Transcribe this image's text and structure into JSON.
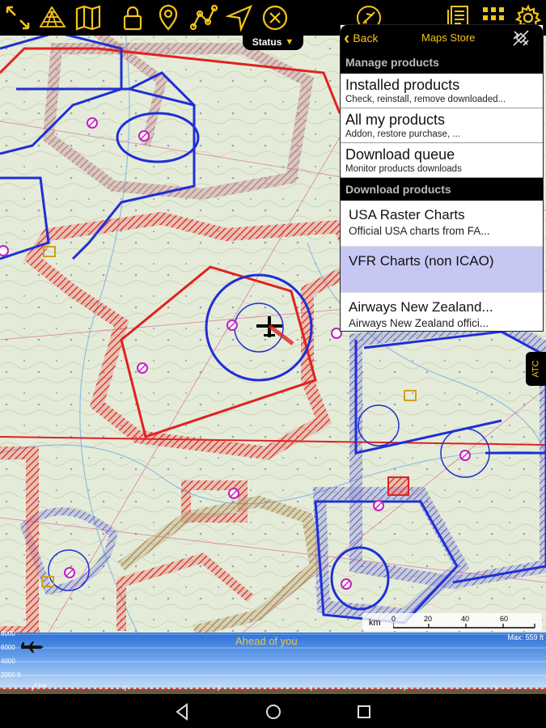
{
  "status_tab": {
    "label": "Status",
    "arrow": "▼"
  },
  "store": {
    "back_label": "Back",
    "title": "Maps Store",
    "manage_section": "Manage products",
    "manage_items": [
      {
        "title": "Installed products",
        "subtitle": "Check, reinstall, remove downloaded..."
      },
      {
        "title": "All my products",
        "subtitle": "Addon, restore purchase, ..."
      },
      {
        "title": "Download queue",
        "subtitle": "Monitor products downloads"
      }
    ],
    "download_section": "Download products",
    "download_items": [
      {
        "title": "USA Raster Charts",
        "subtitle": "Official USA charts from FA...",
        "selected": false
      },
      {
        "title": "VFR Charts (non ICAO)",
        "subtitle": "",
        "selected": true
      },
      {
        "title": "Airways New Zealand...",
        "subtitle": "Airways New Zealand offici...",
        "selected": false
      }
    ]
  },
  "atc_tab": {
    "label": "ATC"
  },
  "scale": {
    "unit": "km",
    "labels": [
      "0",
      "20",
      "40",
      "60"
    ]
  },
  "profile": {
    "ahead_label": "Ahead of you",
    "max_label": "Max: 559 ft",
    "alt_labels": [
      "8000",
      "6000",
      "4000",
      "2000 ft"
    ],
    "dist_label": "0 km"
  },
  "colors": {
    "accent": "#f5c518",
    "selected": "#c7c7f3",
    "airspace_red": "#e0221f",
    "airspace_blue": "#1f2fd6"
  },
  "icons": {
    "toolbar": [
      "expand-icon",
      "terrain-icon",
      "map-icon",
      "lock-icon",
      "pin-icon",
      "route-icon",
      "navigate-icon",
      "close-circle-icon",
      "flight-plan-icon",
      "checklist-icon",
      "grid-icon",
      "settings-icon"
    ]
  }
}
